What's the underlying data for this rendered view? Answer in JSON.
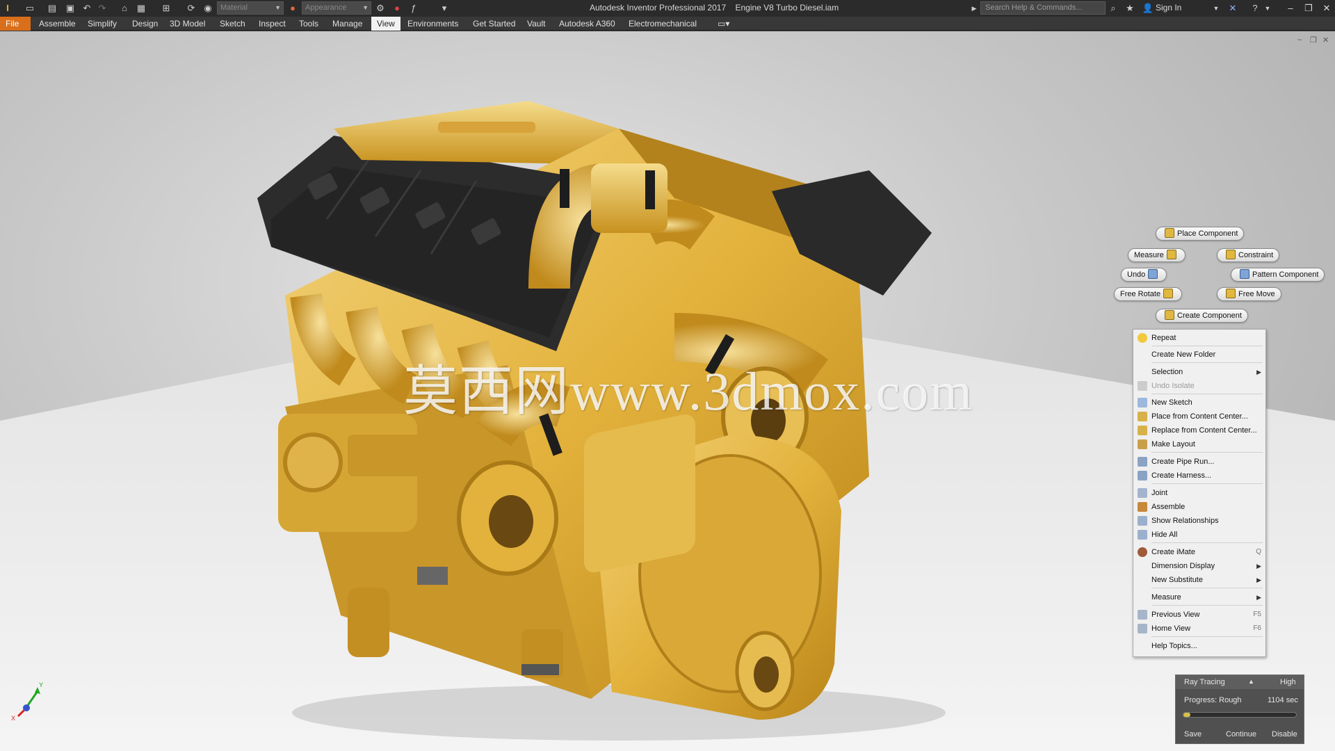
{
  "titlebar": {
    "app_title": "Autodesk Inventor Professional 2017",
    "document": "Engine V8 Turbo Diesel.iam",
    "material_placeholder": "Material",
    "appearance_placeholder": "Appearance",
    "search_placeholder": "Search Help & Commands...",
    "sign_in": "Sign In"
  },
  "ribbon": {
    "tabs": [
      "File",
      "Assemble",
      "Simplify",
      "Design",
      "3D Model",
      "Sketch",
      "Inspect",
      "Tools",
      "Manage",
      "View",
      "Environments",
      "Get Started",
      "Vault",
      "Autodesk A360",
      "Electromechanical"
    ],
    "active_tab": "View"
  },
  "viewport": {
    "watermark": "莫西网www.3dmox.com"
  },
  "marking_menu": {
    "place_component": "Place Component",
    "measure": "Measure",
    "constraint": "Constraint",
    "undo": "Undo",
    "pattern_component": "Pattern Component",
    "free_rotate": "Free Rotate",
    "free_move": "Free Move",
    "create_component": "Create Component"
  },
  "context_menu": {
    "items": [
      {
        "label": "Repeat",
        "shortcut": ""
      },
      {
        "label": "Create New Folder",
        "shortcut": ""
      },
      {
        "label": "Selection",
        "shortcut": ""
      },
      {
        "label": "Undo Isolate",
        "shortcut": ""
      },
      {
        "label": "New Sketch",
        "shortcut": ""
      },
      {
        "label": "Place from Content Center...",
        "shortcut": ""
      },
      {
        "label": "Replace from Content Center...",
        "shortcut": ""
      },
      {
        "label": "Make Layout",
        "shortcut": ""
      },
      {
        "label": "Create Pipe Run...",
        "shortcut": ""
      },
      {
        "label": "Create Harness...",
        "shortcut": ""
      },
      {
        "label": "Joint",
        "shortcut": ""
      },
      {
        "label": "Assemble",
        "shortcut": ""
      },
      {
        "label": "Show Relationships",
        "shortcut": ""
      },
      {
        "label": "Hide All",
        "shortcut": ""
      },
      {
        "label": "Create iMate",
        "shortcut": "Q"
      },
      {
        "label": "Dimension Display",
        "shortcut": ""
      },
      {
        "label": "New Substitute",
        "shortcut": ""
      },
      {
        "label": "Measure",
        "shortcut": ""
      },
      {
        "label": "Previous View",
        "shortcut": "F5"
      },
      {
        "label": "Home View",
        "shortcut": "F6"
      },
      {
        "label": "Help Topics...",
        "shortcut": ""
      }
    ]
  },
  "ray_tracing": {
    "title": "Ray Tracing",
    "quality": "High",
    "progress_label": "Progress: Rough",
    "time": "1104 sec",
    "progress_fraction": 0.06,
    "save": "Save",
    "continue": "Continue",
    "disable": "Disable"
  },
  "axis": {
    "x": "X",
    "y": "Y"
  },
  "colors": {
    "file_tab": "#d96f1b",
    "engine_yellow": "#e3b23c",
    "engine_black": "#2a2a2a",
    "progress": "#d7c24a"
  }
}
